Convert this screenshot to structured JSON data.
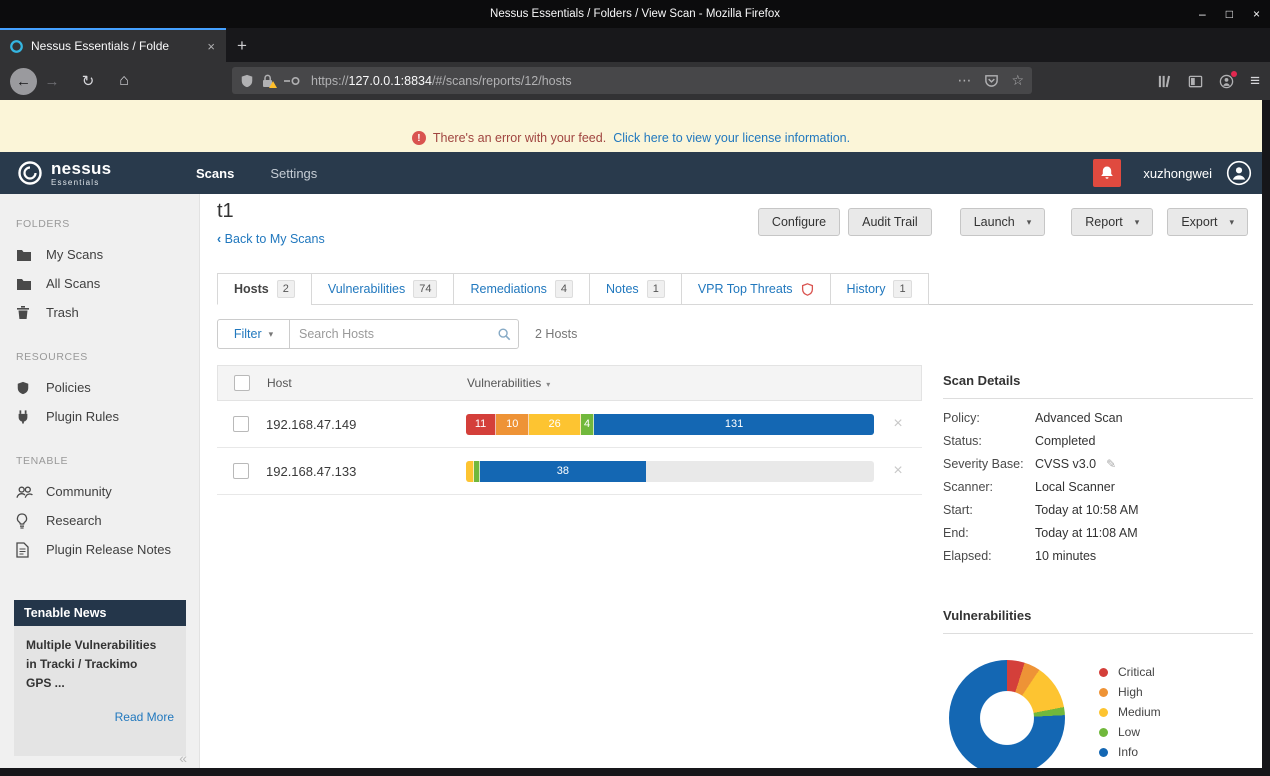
{
  "window": {
    "title": "Nessus Essentials / Folders / View Scan - Mozilla Firefox",
    "controls": {
      "minimize": "–",
      "maximize": "□",
      "close": "×"
    }
  },
  "browser": {
    "tab_title": "Nessus Essentials / Folde",
    "tab_close": "×",
    "new_tab": "+",
    "nav": {
      "back": "←",
      "forward": "→",
      "reload": "↻",
      "home": "⌂"
    },
    "url": {
      "scheme": "https://",
      "host": "127.0.0.1:8834",
      "path": "/#/scans/reports/12/hosts"
    }
  },
  "ui": {
    "caret": "▾",
    "back_chevron": "‹",
    "collapse": "«",
    "ellipsis": "⋯",
    "star": "☆",
    "menu": "≡"
  },
  "banner": {
    "icon": "!",
    "message": "There's an error with your feed.",
    "link": "Click here to view your license information."
  },
  "app_header": {
    "brand": "nessus",
    "brand_sub": "Essentials",
    "nav": [
      {
        "label": "Scans"
      },
      {
        "label": "Settings"
      }
    ],
    "username": "xuzhongwei"
  },
  "sidebar": {
    "sections": [
      {
        "title": "FOLDERS",
        "items": [
          {
            "label": "My Scans"
          },
          {
            "label": "All Scans"
          },
          {
            "label": "Trash"
          }
        ]
      },
      {
        "title": "RESOURCES",
        "items": [
          {
            "label": "Policies"
          },
          {
            "label": "Plugin Rules"
          }
        ]
      },
      {
        "title": "TENABLE",
        "items": [
          {
            "label": "Community"
          },
          {
            "label": "Research"
          },
          {
            "label": "Plugin Release Notes"
          }
        ]
      }
    ],
    "news": {
      "title": "Tenable News",
      "body": "Multiple Vulnerabilities in Tracki / Trackimo GPS ...",
      "link": "Read More"
    }
  },
  "main": {
    "title": "t1",
    "back_label": "Back to My Scans",
    "actions": [
      {
        "label": "Configure"
      },
      {
        "label": "Audit Trail"
      },
      {
        "label": "Launch"
      },
      {
        "label": "Report"
      },
      {
        "label": "Export"
      }
    ],
    "tabs": [
      {
        "label": "Hosts",
        "badge": "2"
      },
      {
        "label": "Vulnerabilities",
        "badge": "74"
      },
      {
        "label": "Remediations",
        "badge": "4"
      },
      {
        "label": "Notes",
        "badge": "1"
      },
      {
        "label": "VPR Top Threats",
        "badge": ""
      },
      {
        "label": "History",
        "badge": "1"
      }
    ],
    "filter": {
      "label": "Filter",
      "placeholder": "Search Hosts",
      "count": "2 Hosts"
    },
    "table": {
      "headers": {
        "host": "Host",
        "vulnerabilities": "Vulnerabilities"
      },
      "rows": [
        {
          "host": "192.168.47.149",
          "bar": {
            "segments": [
              {
                "severity": "critical",
                "count": "11",
                "width_pct": 7.4
              },
              {
                "severity": "high",
                "count": "10",
                "width_pct": 8.1
              },
              {
                "severity": "medium",
                "count": "26",
                "width_pct": 12.7
              },
              {
                "severity": "low",
                "count": "4",
                "width_pct": 3.2
              },
              {
                "severity": "info",
                "count": "131",
                "width_pct": 68.6
              }
            ]
          }
        },
        {
          "host": "192.168.47.133",
          "bar": {
            "segments": [
              {
                "severity": "medium",
                "count": "",
                "width_pct": 2.0
              },
              {
                "severity": "low",
                "count": "",
                "width_pct": 1.5
              },
              {
                "severity": "info",
                "count": "38",
                "width_pct": 40.5
              }
            ]
          }
        }
      ]
    }
  },
  "details": {
    "title": "Scan Details",
    "edit_icon": "✎",
    "rows": [
      {
        "label": "Policy:",
        "value": "Advanced Scan"
      },
      {
        "label": "Status:",
        "value": "Completed"
      },
      {
        "label": "Severity Base:",
        "value": "CVSS v3.0"
      },
      {
        "label": "Scanner:",
        "value": "Local Scanner"
      },
      {
        "label": "Start:",
        "value": "Today at 10:58 AM"
      },
      {
        "label": "End:",
        "value": "Today at 11:08 AM"
      },
      {
        "label": "Elapsed:",
        "value": "10 minutes"
      }
    ]
  },
  "severity_colors": {
    "critical": "#d43f3a",
    "high": "#ee9336",
    "medium": "#fdc431",
    "low": "#71b83c",
    "info": "#1467b3"
  },
  "chart_data": {
    "type": "donut",
    "title": "Vulnerabilities",
    "labels": [
      "Critical",
      "High",
      "Medium",
      "Low",
      "Info"
    ],
    "severity_keys": [
      "critical",
      "high",
      "medium",
      "low",
      "info"
    ],
    "values": [
      11,
      10,
      28,
      5,
      169
    ],
    "legend_position": "right"
  }
}
